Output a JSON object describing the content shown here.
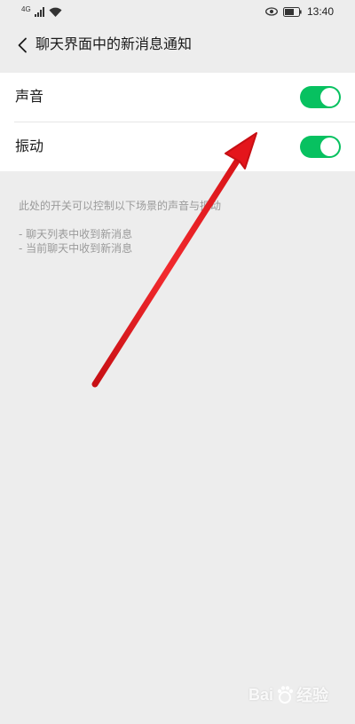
{
  "status_bar": {
    "network": "4G",
    "time": "13:40"
  },
  "header": {
    "title": "聊天界面中的新消息通知"
  },
  "settings": [
    {
      "label": "声音",
      "enabled": true
    },
    {
      "label": "振动",
      "enabled": true
    }
  ],
  "hint": {
    "text": "此处的开关可以控制以下场景的声音与振动",
    "items": [
      "- 聊天列表中收到新消息",
      "- 当前聊天中收到新消息"
    ]
  },
  "annotation": {
    "arrow_color": "#e4151b"
  },
  "colors": {
    "toggle_on": "#07c160",
    "background": "#ededed"
  },
  "watermark": {
    "brand": "Bai",
    "suffix": "经验"
  }
}
